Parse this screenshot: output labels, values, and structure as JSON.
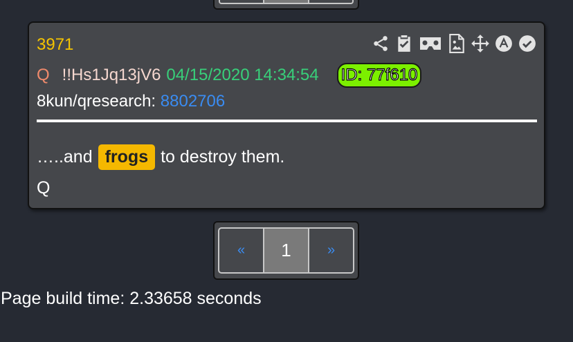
{
  "post": {
    "number": "3971",
    "author": "Q",
    "tripcode": "!!Hs1Jq13jV6",
    "timestamp": "04/15/2020 14:34:54",
    "id_badge": "ID: 77f610",
    "source_label": "8kun/qresearch: ",
    "source_link": "8802706",
    "body_prefix": "…..and",
    "body_highlight": "frogs",
    "body_suffix": "to destroy them.",
    "signature": "Q",
    "icons": [
      "share-icon",
      "clipboard-check-icon",
      "vr-goggles-icon",
      "image-file-icon",
      "move-icon",
      "a-circle-icon",
      "check-circle-icon"
    ]
  },
  "pagination": {
    "prev": "«",
    "current": "1",
    "next": "»"
  },
  "footer": {
    "build_time": "Page build time: 2.33658 seconds"
  },
  "colors": {
    "background": "#262a33",
    "post_bg": "#45474b",
    "post_number": "#f5c400",
    "author": "#f08a6c",
    "timestamp": "#38d07a",
    "id_badge": "#7cf000",
    "link": "#3a8cf2",
    "highlight": "#f5b800"
  }
}
